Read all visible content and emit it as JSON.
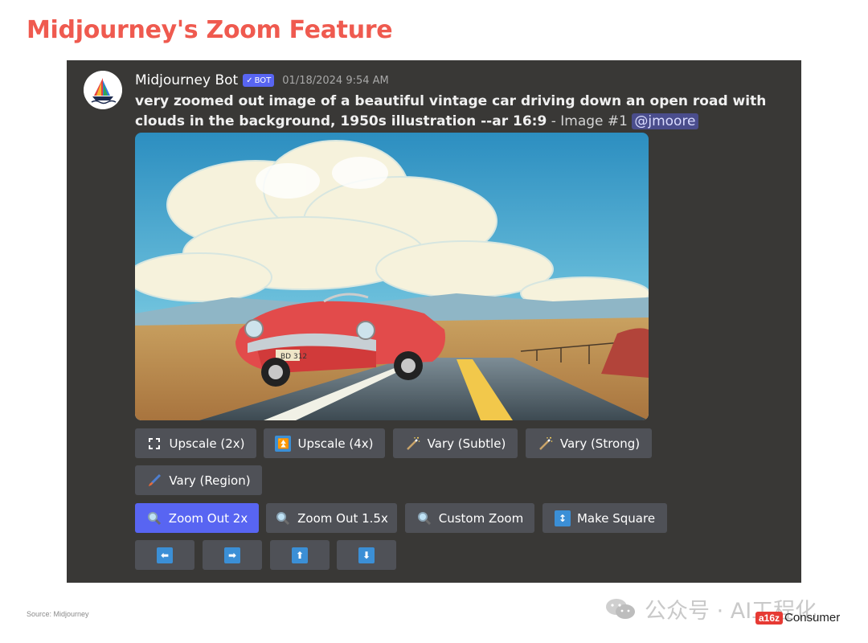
{
  "slide": {
    "title": "Midjourney's Zoom Feature",
    "source": "Source: Midjourney"
  },
  "message": {
    "author": "Midjourney Bot",
    "badge": "BOT",
    "timestamp": "01/18/2024 9:54 AM",
    "prompt": "very zoomed out image of a beautiful vintage car driving down an open road with clouds in the background, 1950s illustration --ar 16:9",
    "suffix": " - Image #1 ",
    "mention": "@jmoore",
    "license_plate": "BD 312"
  },
  "buttons": {
    "row1": [
      {
        "label": "Upscale (2x)",
        "icon": "expand-icon"
      },
      {
        "label": "Upscale (4x)",
        "icon": "arrow-up-box-icon"
      },
      {
        "label": "Vary (Subtle)",
        "icon": "magic-wand-icon"
      },
      {
        "label": "Vary (Strong)",
        "icon": "magic-wand-icon"
      }
    ],
    "row2": [
      {
        "label": "Vary (Region)",
        "icon": "paintbrush-icon"
      }
    ],
    "row3": [
      {
        "label": "Zoom Out 2x",
        "icon": "magnifier-icon",
        "active": true
      },
      {
        "label": "Zoom Out 1.5x",
        "icon": "magnifier-icon"
      },
      {
        "label": "Custom Zoom",
        "icon": "magnifier-icon"
      },
      {
        "label": "Make Square",
        "icon": "up-down-arrow-icon"
      }
    ],
    "row4": [
      {
        "icon": "left-arrow-icon",
        "glyph": "⬅"
      },
      {
        "icon": "right-arrow-icon",
        "glyph": "➡"
      },
      {
        "icon": "up-arrow-icon",
        "glyph": "⬆"
      },
      {
        "icon": "down-arrow-icon",
        "glyph": "⬇"
      }
    ]
  },
  "watermark": {
    "text": "公众号 · AI工程化",
    "brand_badge": "a16z",
    "brand_text": "Consumer"
  },
  "colors": {
    "title": "#ef5a4f",
    "panel": "#393836",
    "button": "#4f5157",
    "primary_button": "#5865f2",
    "mention_bg": "#4a4d8c"
  }
}
